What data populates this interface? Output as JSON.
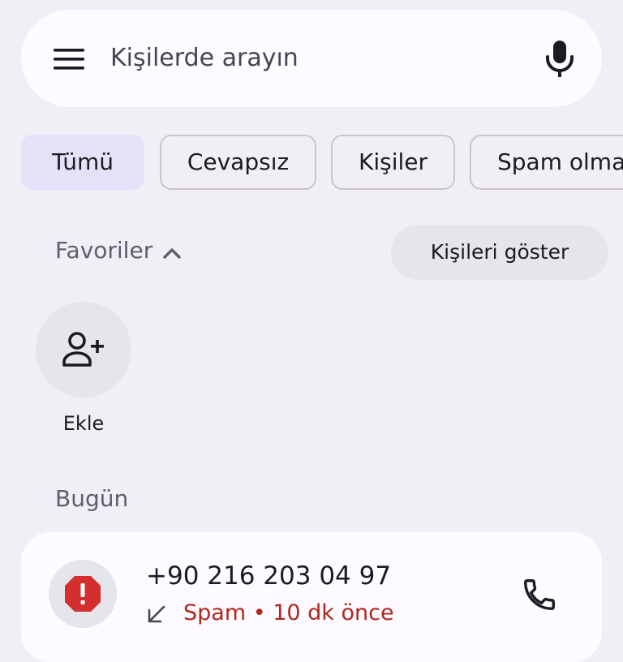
{
  "search": {
    "placeholder": "Kişilerde arayın",
    "menu_icon": "hamburger-menu-icon",
    "mic_icon": "microphone-icon"
  },
  "filters": [
    {
      "label": "Tümü",
      "selected": true
    },
    {
      "label": "Cevapsız",
      "selected": false
    },
    {
      "label": "Kişiler",
      "selected": false
    },
    {
      "label": "Spam olma",
      "selected": false
    }
  ],
  "favorites": {
    "title": "Favoriler",
    "toggle_icon": "chevron-up-icon",
    "show_contacts_label": "Kişileri göster",
    "add_label": "Ekle",
    "add_icon": "person-add-icon"
  },
  "recents": {
    "section_title": "Bugün",
    "calls": [
      {
        "number": "+90 216 203 04 97",
        "status": "Spam • 10 dk önce",
        "avatar_icon": "spam-warning-icon",
        "direction_icon": "incoming-call-arrow-icon",
        "action_icon": "phone-icon"
      }
    ]
  },
  "colors": {
    "background": "#f1eff5",
    "surface": "#fdfbff",
    "selected_chip": "#e4e2f8",
    "spam_red": "#b3261e"
  }
}
